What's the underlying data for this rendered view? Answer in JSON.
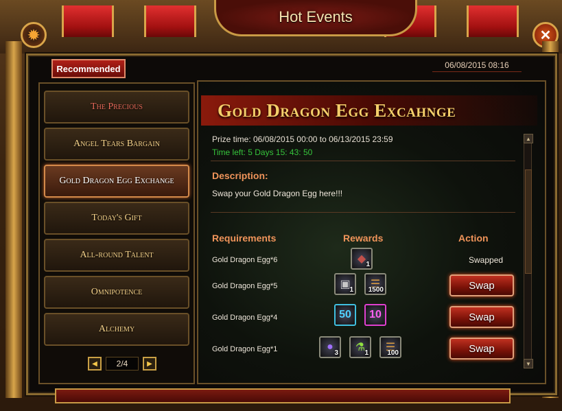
{
  "window": {
    "title": "Hot Events"
  },
  "tag": "Recommended",
  "datetime": "06/08/2015 08:16",
  "sidebar": {
    "items": [
      {
        "label": "The Precious"
      },
      {
        "label": "Angel Tears Bargain"
      },
      {
        "label": "Gold Dragon Egg Exchange"
      },
      {
        "label": "Today's Gift"
      },
      {
        "label": "All-round Talent"
      },
      {
        "label": "Omnipotence"
      },
      {
        "label": "Alchemy"
      }
    ],
    "active_index": 2,
    "pager": {
      "page": "2/4"
    }
  },
  "event": {
    "title": "Gold Dragon Egg Excahnge",
    "prize_time": "Prize time: 06/08/2015 00:00 to 06/13/2015 23:59",
    "time_left": "Time left: 5 Days  15: 43: 50",
    "description_label": "Description:",
    "description": "Swap your Gold Dragon Egg here!!!",
    "headers": {
      "requirements": "Requirements",
      "rewards": "Rewards",
      "action": "Action"
    },
    "rows": [
      {
        "requirement": "Gold Dragon Egg*6",
        "rewards": [
          {
            "icon": "dragon-egg-icon",
            "count": "1"
          }
        ],
        "action": "Swapped"
      },
      {
        "requirement": "Gold Dragon Egg*5",
        "rewards": [
          {
            "icon": "chest-icon",
            "count": "1"
          },
          {
            "icon": "scroll-icon",
            "count": "1500"
          }
        ],
        "action": "Swap"
      },
      {
        "requirement": "Gold Dragon Egg*4",
        "rewards": [
          {
            "icon": "badge-50-icon",
            "count": "50"
          },
          {
            "icon": "badge-10-icon",
            "count": "10"
          }
        ],
        "action": "Swap"
      },
      {
        "requirement": "Gold Dragon Egg*1",
        "rewards": [
          {
            "icon": "orb-icon",
            "count": "3"
          },
          {
            "icon": "potion-icon",
            "count": "1"
          },
          {
            "icon": "scroll-icon",
            "count": "100"
          }
        ],
        "action": "Swap"
      }
    ]
  },
  "colors": {
    "accent": "#f0945a",
    "title_gold": "#f5cf6a",
    "time_green": "#36c43c"
  }
}
